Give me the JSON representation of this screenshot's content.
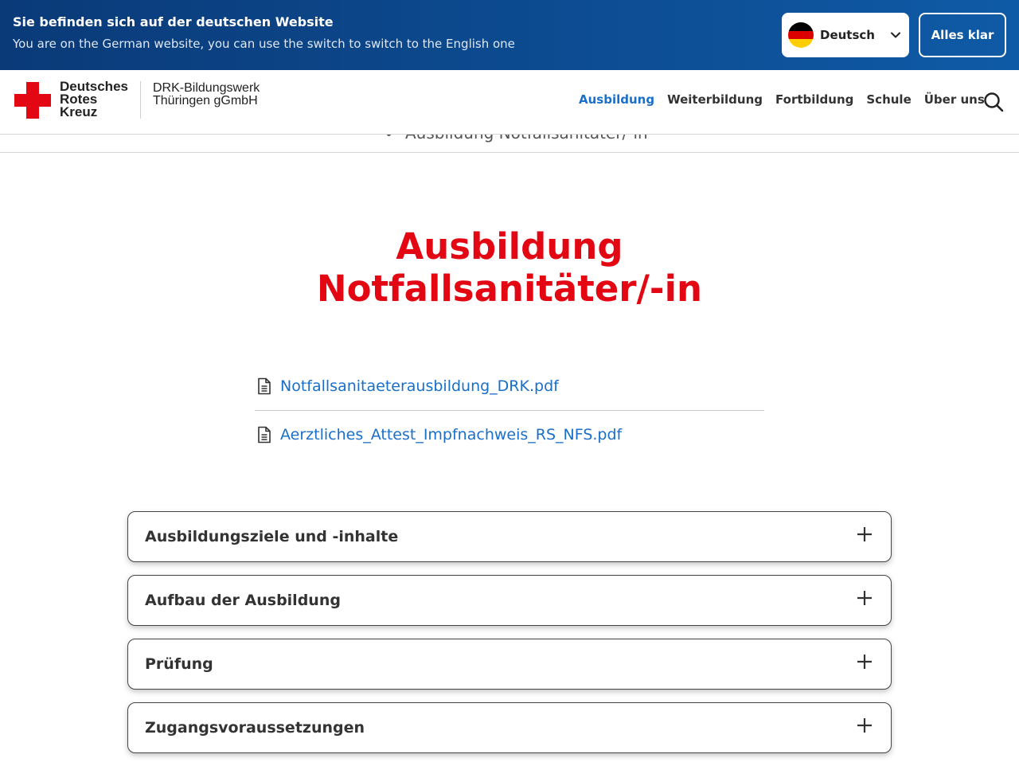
{
  "language_banner": {
    "title": "Sie befinden sich auf der deutschen Website",
    "subtitle": "You are on the German website, you can use the switch to switch to the English one",
    "selected_language": "Deutsch",
    "confirm_label": "Alles klar",
    "flag_icon": "germany-flag-icon",
    "flag_colors": [
      "#000000",
      "#dd0000",
      "#ffce00"
    ]
  },
  "header": {
    "logo": {
      "line1": "Deutsches",
      "line2": "Rotes",
      "line3": "Kreuz"
    },
    "org": {
      "line1": "DRK-Bildungswerk",
      "line2": "Thüringen gGmbH"
    },
    "nav": [
      {
        "label": "Ausbildung",
        "active": true
      },
      {
        "label": "Weiterbildung",
        "active": false
      },
      {
        "label": "Fortbildung",
        "active": false
      },
      {
        "label": "Schule",
        "active": false
      },
      {
        "label": "Über uns",
        "active": false
      }
    ]
  },
  "breadcrumb": {
    "current": "Ausbildung Notfallsanitäter/-in"
  },
  "page": {
    "title_line1": "Ausbildung",
    "title_line2": "Notfallsanitäter/-in"
  },
  "downloads": [
    {
      "filename": "Notfallsanitaeterausbildung_DRK.pdf"
    },
    {
      "filename": "Aerztliches_Attest_Impfnachweis_RS_NFS.pdf"
    }
  ],
  "accordion": [
    {
      "label": "Ausbildungsziele und -inhalte"
    },
    {
      "label": "Aufbau der Ausbildung"
    },
    {
      "label": "Prüfung"
    },
    {
      "label": "Zugangsvoraussetzungen"
    }
  ],
  "colors": {
    "brand_red": "#e30613",
    "link_blue": "#1a6fc9",
    "banner_blue": "#0f5aa6"
  }
}
